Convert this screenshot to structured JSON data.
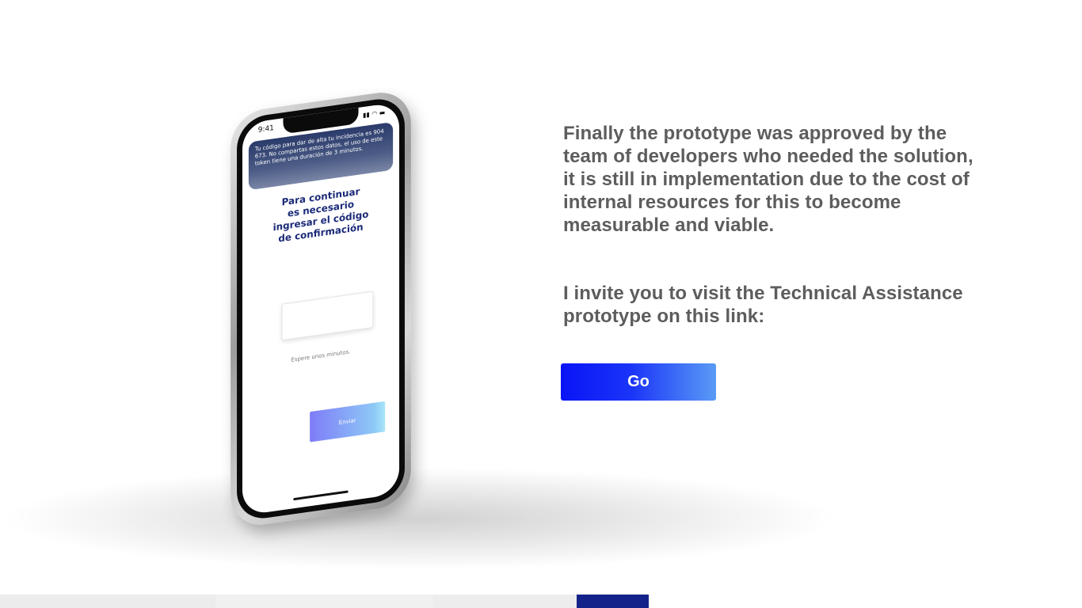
{
  "phone_screen": {
    "status_time": "9:41",
    "notification": "Tu código para dar de alta tu incidencia es 904 673. No compartas estos datos, el uso de este token tiene una duración de 3 minutos.",
    "heading_lines": [
      "Para continuar",
      "es necesario",
      "ingresar el código",
      "de confirmación"
    ],
    "wait_text": "Espere unos minutos.",
    "send_label": "Enviar"
  },
  "content": {
    "paragraph1": "Finally the prototype was approved by the team of developers who needed the solution, it is still in implementation due to the cost of internal resources for this to become measurable and viable.",
    "paragraph2": "I invite you to visit the Technical Assistance prototype on this link:",
    "go_label": "Go"
  },
  "colors": {
    "heading_text": "#5d5d5d",
    "go_button_start": "#0a14f6",
    "go_button_end": "#5a9bf5",
    "phone_heading": "#1b2a78",
    "bottom_accent": "#14238a"
  }
}
